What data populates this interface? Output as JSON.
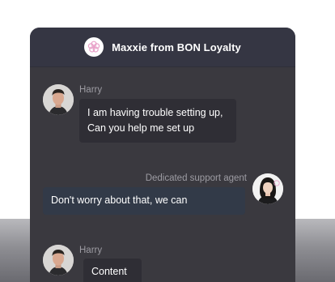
{
  "header": {
    "title": "Maxxie from BON Loyalty"
  },
  "messages": [
    {
      "sender": "Harry",
      "lines": [
        "I am having trouble setting up,",
        "Can you help me set up"
      ]
    },
    {
      "sender": "Dedicated support agent",
      "lines": [
        "Don't worry about that, we can"
      ]
    },
    {
      "sender": "Harry",
      "lines": [
        "Content"
      ]
    }
  ],
  "colors": {
    "panel": "#3a393f",
    "header": "#353643",
    "user_bubble": "#2f2e35",
    "agent_bubble": "#323a48",
    "brand_logo_accent": "#e8a0c8"
  }
}
